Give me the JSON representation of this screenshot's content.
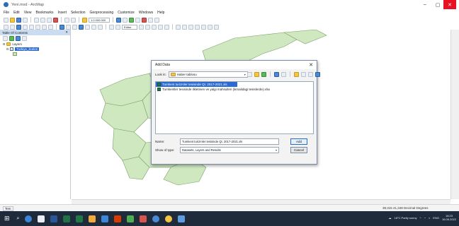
{
  "window": {
    "title": "Yeni.mxd - ArcMap"
  },
  "menu": [
    "File",
    "Edit",
    "View",
    "Bookmarks",
    "Insert",
    "Selection",
    "Geoprocessing",
    "Customize",
    "Windows",
    "Help"
  ],
  "toolbar": {
    "scale": "1:2.000.000",
    "editor_label": "Editor"
  },
  "toc": {
    "title": "Table Of Contents",
    "root_label": "Layers",
    "layer_label": "Turkiye_ilceleri"
  },
  "dialog": {
    "title": "Add Data",
    "look_in_label": "Look in:",
    "look_in_value": "Haber tablosu",
    "files": [
      "Tumkent turizmler tesisinde Qt. 2017-2021.xls",
      "Tumkentler tesisinde ilkletinen ve yalgi mahsulleri (ikmalidagi tesislerde).xlsx"
    ],
    "name_label": "Name:",
    "name_value": "Tumkent turizmler tesisinde Qt. 2017-2021.xls",
    "show_label": "Show of type:",
    "show_value": "Datasets, Layers and Results",
    "add_button": "Add",
    "cancel_button": "Cancel"
  },
  "status": {
    "left": "Tem",
    "coordinates": "38,315  41,348 Decimal Degrees"
  },
  "taskbar": {
    "weather": "18°C  Partly sunny",
    "lang": "ENG",
    "time": "16:23",
    "date": "16.05.2022"
  },
  "colors": {
    "map_polygon_fill": "#cfe8bf",
    "map_polygon_stroke": "#7aa06a",
    "selection": "#2b6bd1",
    "taskbar": "#1f2b3a"
  }
}
